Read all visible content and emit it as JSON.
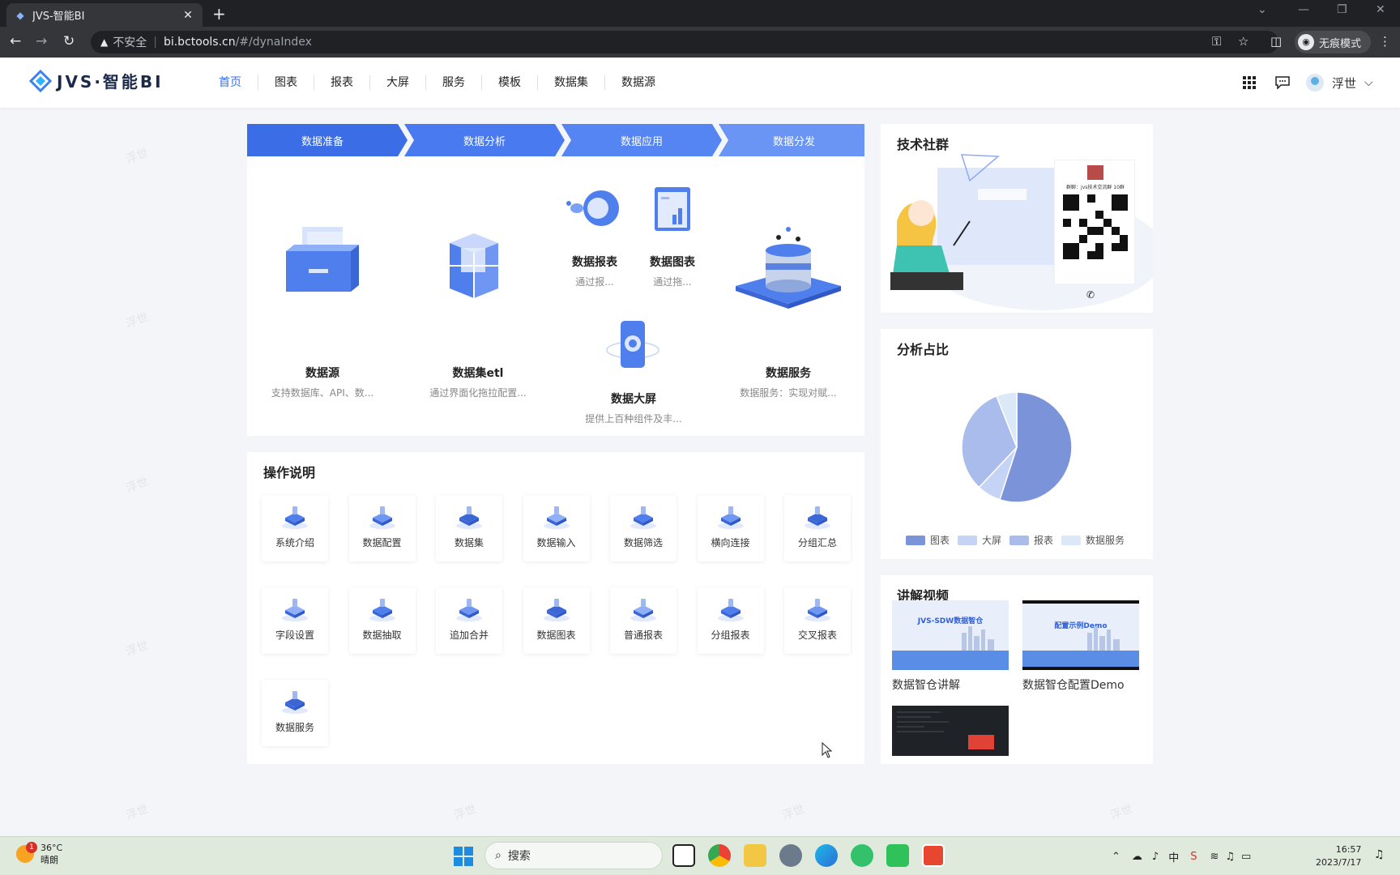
{
  "browser": {
    "tab_title": "JVS-智能BI",
    "new_tab": "+",
    "security": "不安全",
    "url_domain": "bi.bctools.cn",
    "url_path": "/#/dynaIndex",
    "incognito_label": "无痕模式"
  },
  "header": {
    "logo_text": "JVS·智能BI",
    "nav": [
      "首页",
      "图表",
      "报表",
      "大屏",
      "服务",
      "模板",
      "数据集",
      "数据源"
    ],
    "user_name": "浮世"
  },
  "flow": {
    "steps": [
      "数据准备",
      "数据分析",
      "数据应用",
      "数据分发"
    ]
  },
  "tiles": {
    "datasource": {
      "name": "数据源",
      "desc": "支持数据库、API、数..."
    },
    "dataset": {
      "name": "数据集etl",
      "desc": "通过界面化拖拉配置..."
    },
    "report": {
      "name": "数据报表",
      "desc": "通过报..."
    },
    "chart": {
      "name": "数据图表",
      "desc": "通过拖..."
    },
    "screen": {
      "name": "数据大屏",
      "desc": "提供上百种组件及丰..."
    },
    "service": {
      "name": "数据服务",
      "desc": "数据服务：实现对赋..."
    }
  },
  "operations": {
    "title": "操作说明",
    "items": [
      "系统介绍",
      "数据配置",
      "数据集",
      "数据输入",
      "数据筛选",
      "横向连接",
      "分组汇总",
      "字段设置",
      "数据抽取",
      "追加合并",
      "数据图表",
      "普通报表",
      "分组报表",
      "交叉报表",
      "数据服务"
    ]
  },
  "community": {
    "title": "技术社群",
    "qr_caption": "群聊：jvs技术交流群 10群"
  },
  "analysis": {
    "title": "分析占比",
    "legend": [
      "图表",
      "大屏",
      "报表",
      "数据服务"
    ]
  },
  "chart_data": {
    "type": "pie",
    "categories": [
      "图表",
      "大屏",
      "报表",
      "数据服务"
    ],
    "values": [
      55,
      7,
      32,
      6
    ],
    "colors": [
      "#7b93d9",
      "#c5d3f5",
      "#a9bcec",
      "#dbe8f8"
    ]
  },
  "videos": {
    "title": "讲解视频",
    "items": [
      {
        "caption": "数据智仓讲解",
        "thumb_text": "JVS-SDW数据智仓"
      },
      {
        "caption": "数据智仓配置Demo",
        "thumb_text": "配置示例Demo"
      },
      {
        "caption": ""
      }
    ]
  },
  "watermark": "浮世",
  "taskbar": {
    "temperature": "36°C",
    "weather": "晴朗",
    "weather_badge": "1",
    "search": "搜索",
    "ime": "中",
    "time": "16:57",
    "date": "2023/7/17"
  }
}
